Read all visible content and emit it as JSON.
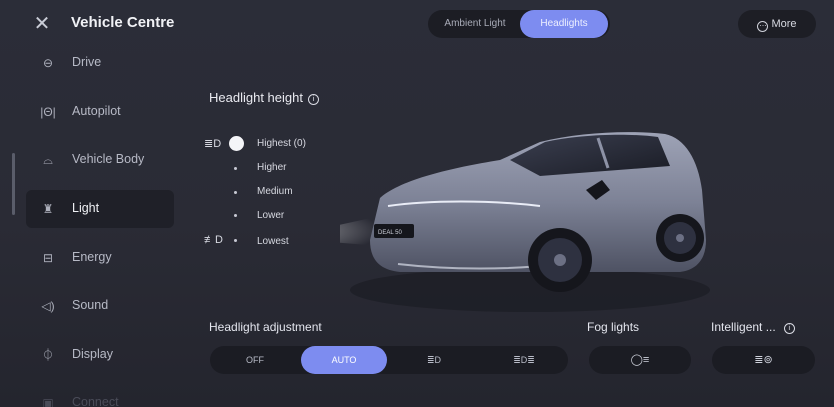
{
  "app": {
    "title": "Vehicle Centre",
    "close_icon": "✕"
  },
  "tabs": [
    {
      "label": "Ambient Light",
      "active": false
    },
    {
      "label": "Headlights",
      "active": true
    }
  ],
  "more": {
    "icon": "⊙",
    "label": "More"
  },
  "sidebar": {
    "items": [
      {
        "label": "Drive",
        "icon": "⊖"
      },
      {
        "label": "Autopilot",
        "icon": "|Θ|"
      },
      {
        "label": "Vehicle Body",
        "icon": "⌓"
      },
      {
        "label": "Light",
        "icon": "♜",
        "active": true
      },
      {
        "label": "Energy",
        "icon": "⊟"
      },
      {
        "label": "Sound",
        "icon": "◁)"
      },
      {
        "label": "Display",
        "icon": "⏀"
      },
      {
        "label": "Connect",
        "icon": "▣"
      }
    ]
  },
  "headlight_height": {
    "title": "Headlight height",
    "info_icon": "i",
    "top_icon": "≣D",
    "bottom_icon": "≢D",
    "levels": [
      "Highest (0)",
      "Higher",
      "Medium",
      "Lower",
      "Lowest"
    ],
    "selected_level": "Highest (0)"
  },
  "car": {
    "plate": "DEAL 50"
  },
  "controls": {
    "headlight_adjustment": {
      "label": "Headlight adjustment",
      "options": [
        "OFF",
        "AUTO",
        "≣D",
        "≣D≣"
      ],
      "selected": "AUTO"
    },
    "fog_lights": {
      "label": "Fog lights",
      "icon": "◯≡"
    },
    "intelligent": {
      "label": "Intelligent ...",
      "info_icon": "i",
      "icon": "≣⊚"
    }
  },
  "colors": {
    "accent": "#7d8cf0",
    "background": "#2b2d38",
    "panel": "#1b1c23"
  }
}
